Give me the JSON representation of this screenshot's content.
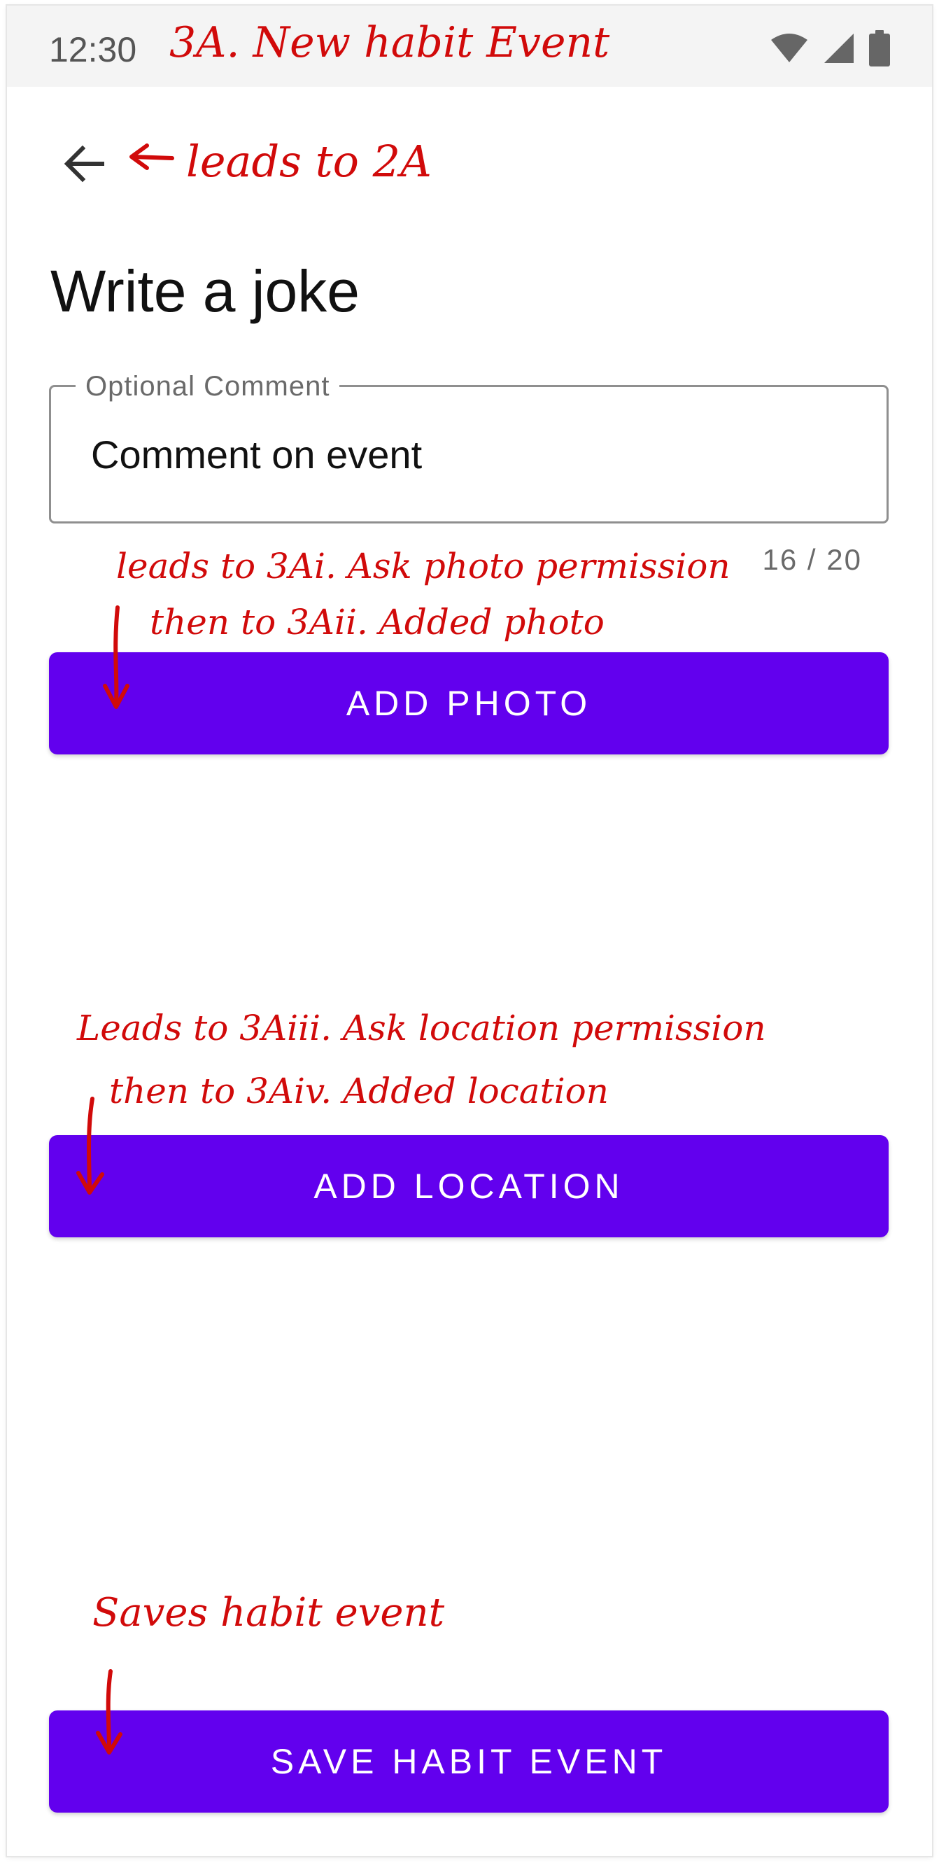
{
  "status_bar": {
    "time": "12:30",
    "icons": [
      "wifi-icon",
      "signal-icon",
      "battery-icon"
    ]
  },
  "toolbar": {
    "back_icon": "arrow-back-icon"
  },
  "habit": {
    "title": "Write a joke"
  },
  "comment_field": {
    "label": "Optional Comment",
    "value": "Comment on event",
    "counter": "16 / 20"
  },
  "buttons": {
    "add_photo": "ADD PHOTO",
    "add_location": "ADD LOCATION",
    "save": "SAVE HABIT EVENT"
  },
  "annotations": {
    "screen_title": "3A. New habit Event",
    "back_note": "leads to 2A",
    "photo_note_1": "leads to 3Ai. Ask photo permission",
    "photo_note_2": "then to 3Aii. Added photo",
    "location_note_1": "Leads to 3Aiii. Ask location permission",
    "location_note_2": "then to 3Aiv. Added location",
    "save_note": "Saves habit event"
  },
  "colors": {
    "primary": "#6200ee",
    "annotation": "#d10a0a",
    "status_bar_bg": "#f4f4f4"
  }
}
